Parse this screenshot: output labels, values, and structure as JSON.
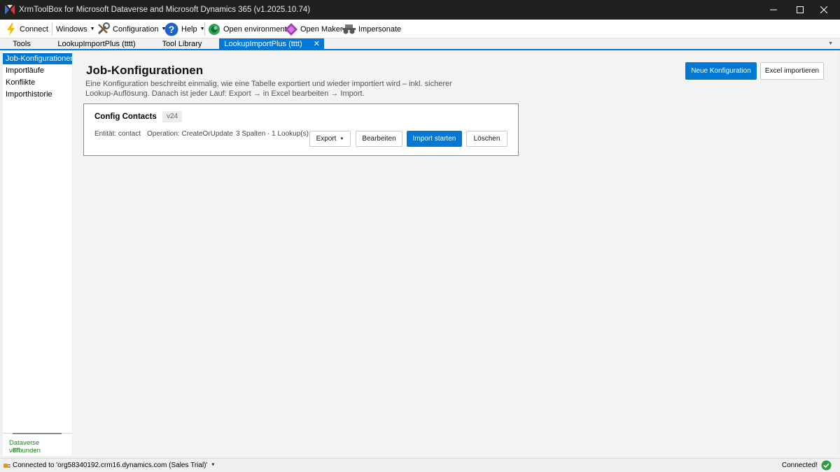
{
  "window": {
    "title": "XrmToolBox for Microsoft Dataverse and Microsoft Dynamics 365 (v1.2025.10.74)",
    "controls": [
      "minimize-icon",
      "maximize-icon",
      "close-icon"
    ]
  },
  "toolbar": {
    "connect": "Connect",
    "windows": "Windows",
    "configuration": "Configuration",
    "help": "Help",
    "open_environment": "Open environment",
    "open_maker": "Open Maker",
    "impersonate": "Impersonate"
  },
  "tabs": [
    {
      "label": "Tools",
      "active": false
    },
    {
      "label": "LookupImportPlus (tttt)",
      "active": false
    },
    {
      "label": "Tool Library",
      "active": false
    },
    {
      "label": "LookupImportPlus (tttt)",
      "active": true
    }
  ],
  "sidebar": {
    "items": [
      {
        "label": "Job-Konfigurationen",
        "selected": true
      },
      {
        "label": "Importläufe",
        "selected": false
      },
      {
        "label": "Konflikte",
        "selected": false
      },
      {
        "label": "Importhistorie",
        "selected": false
      }
    ],
    "status": "Dataverse verbunden",
    "status_user": "tttt"
  },
  "main": {
    "title": "Job-Konfigurationen",
    "description": "Eine Konfiguration beschreibt einmalig, wie eine Tabelle exportiert und wieder importiert wird – inkl. sicherer Lookup-Auflösung. Danach ist jeder Lauf: Export → in Excel bearbeiten → Import.",
    "new_config_button": "Neue Konfiguration",
    "import_excel_button": "Excel importieren",
    "card": {
      "title": "Config Contacts",
      "version": "v24",
      "entity": "Entität: contact",
      "operation": "Operation: CreateOrUpdate",
      "summary": "3 Spalten · 1 Lookup(s)",
      "export_button": "Export",
      "edit_button": "Bearbeiten",
      "start_button": "Import starten",
      "delete_button": "Löschen"
    }
  },
  "statusbar": {
    "connection": "Connected to 'org58340192.crm16.dynamics.com (Sales Trial)'",
    "status": "Connected!"
  },
  "colors": {
    "accent": "#0078d7",
    "titlebar": "#202020",
    "success": "#1a8a1a"
  }
}
